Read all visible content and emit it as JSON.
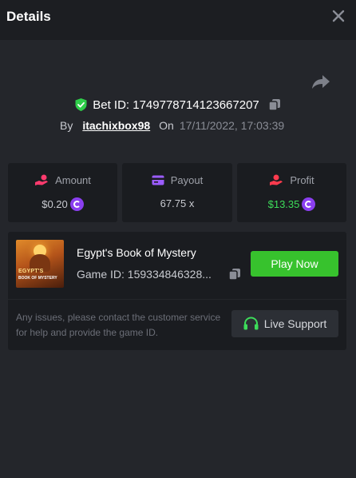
{
  "header": {
    "title": "Details"
  },
  "bet": {
    "label": "Bet ID: 1749778714123667207",
    "by_label": "By",
    "username": "itachixbox98",
    "on_label": "On",
    "date": "17/11/2022, 17:03:39"
  },
  "stats": {
    "amount": {
      "label": "Amount",
      "value": "$0.20"
    },
    "payout": {
      "label": "Payout",
      "value": "67.75 x"
    },
    "profit": {
      "label": "Profit",
      "value": "$13.35"
    }
  },
  "game": {
    "name": "Egypt's Book of Mystery",
    "id_text": "Game ID: 159334846328...",
    "thumb_title": "EGYPT'S",
    "thumb_subtitle": "BOOK OF MYSTERY",
    "play_label": "Play Now"
  },
  "support": {
    "note": "Any issues, please contact the customer service for help and provide the game ID.",
    "button_label": "Live Support"
  },
  "colors": {
    "background": "#24262b",
    "header": "#1c1e22",
    "card": "#1a1c20",
    "accent_green": "#37c22d",
    "profit_green": "#3ddc5a",
    "coin_purple": "#8b3ff0",
    "amount_icon": "#ff3b6e",
    "payout_icon": "#9b5cff",
    "profit_icon": "#ff3b4e"
  },
  "icons": {
    "close": "close-icon",
    "share": "share-icon",
    "shield": "shield-check-icon",
    "copy": "copy-icon",
    "amount": "hand-coin-icon",
    "payout": "wallet-card-icon",
    "profit": "hand-profit-icon",
    "coin": "currency-coin-icon",
    "headset": "headset-icon"
  }
}
